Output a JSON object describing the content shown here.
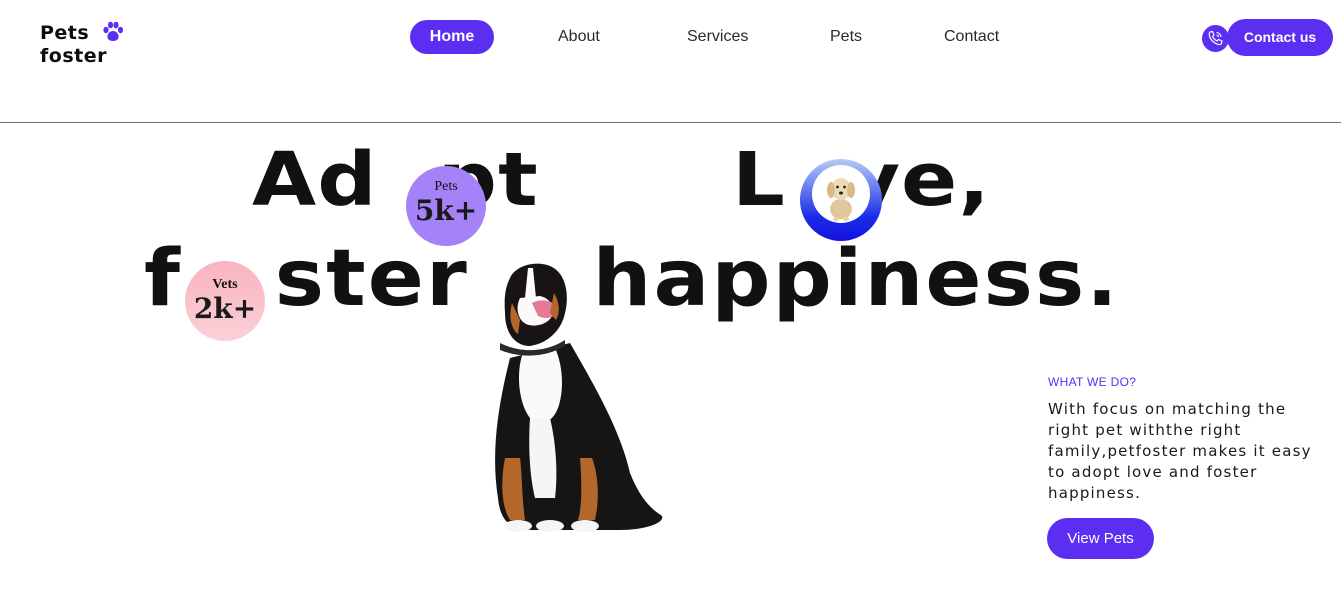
{
  "logo": {
    "line1": "Pets",
    "line2": "foster",
    "icon": "paw-icon"
  },
  "nav": {
    "home": "Home",
    "about": "About",
    "services": "Services",
    "pets": "Pets",
    "contact": "Contact"
  },
  "header": {
    "phone_icon": "phone-icon",
    "contact_button": "Contact us"
  },
  "hero": {
    "line1_part1": "Ad  pt",
    "line1_part2": "L  ve,",
    "line2": "f   ster    happiness.",
    "badge_pets": {
      "label": "Pets",
      "value": "5k+"
    },
    "badge_vets": {
      "label": "Vets",
      "value": "2k+"
    },
    "images": [
      "puppy-image",
      "dog-image"
    ]
  },
  "info": {
    "label": "WHAT WE DO?",
    "description": "With focus on matching the right pet withthe right family,petfoster makes it easy to adopt love and foster happiness.",
    "button": "View Pets"
  },
  "colors": {
    "accent": "#5b2ef2",
    "badge_pets": "#a582f7",
    "badge_vets": "#f9b3bf",
    "love_circle": "#1a2ee8"
  }
}
